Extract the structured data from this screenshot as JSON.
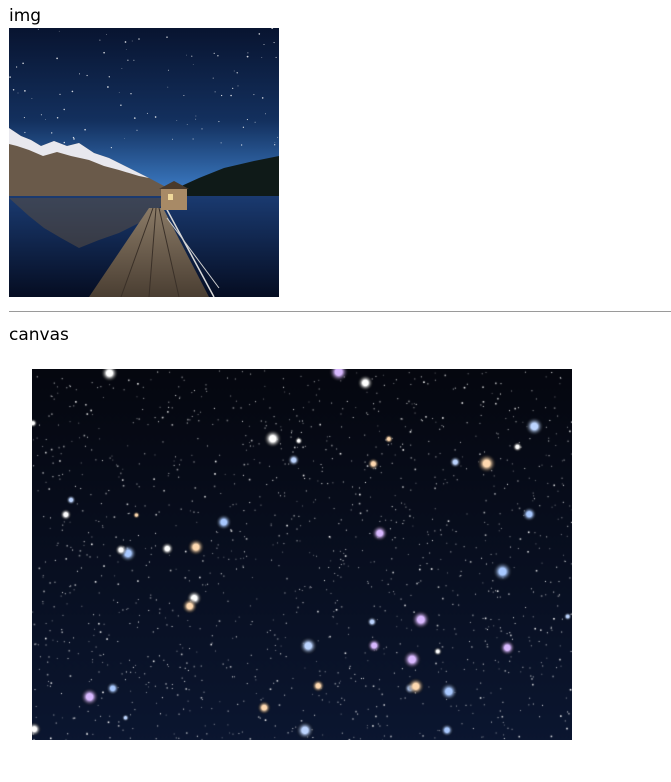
{
  "sections": {
    "img_label": "img",
    "canvas_label": "canvas"
  },
  "images": {
    "photo_scene": "night-sky-lake-with-wooden-pier-and-snowy-mountains",
    "canvas_scene": "dense-starfield"
  },
  "colors": {
    "text": "#000000",
    "divider": "#9a9a9a",
    "sky_top": "#0a1530",
    "sky_horizon": "#2a5a9a",
    "starfield_bg": "#050a18"
  }
}
